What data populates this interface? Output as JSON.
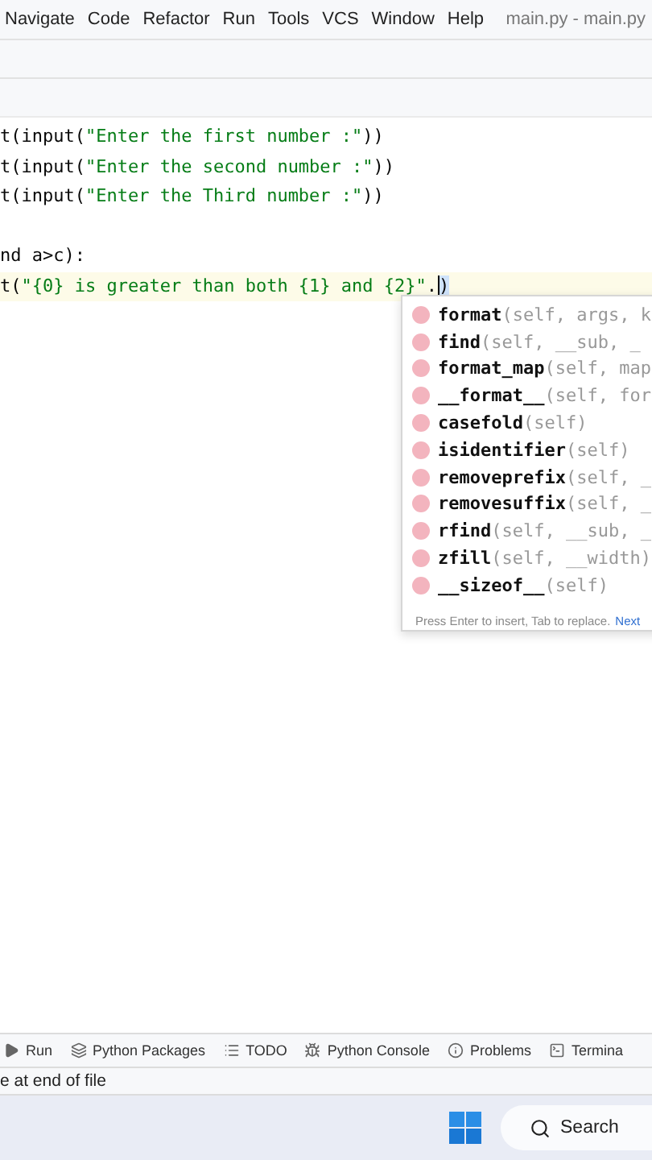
{
  "menu": [
    "Navigate",
    "Code",
    "Refactor",
    "Run",
    "Tools",
    "VCS",
    "Window",
    "Help"
  ],
  "window_title": "main.py - main.py",
  "code_lines": [
    {
      "current": false,
      "segments": [
        {
          "kind": "plain",
          "text": "t(input("
        },
        {
          "kind": "string",
          "text": "\"Enter the first number :\""
        },
        {
          "kind": "plain",
          "text": "))"
        }
      ]
    },
    {
      "current": false,
      "segments": [
        {
          "kind": "plain",
          "text": "t(input("
        },
        {
          "kind": "string",
          "text": "\"Enter the second number :\""
        },
        {
          "kind": "plain",
          "text": "))"
        }
      ]
    },
    {
      "current": false,
      "segments": [
        {
          "kind": "plain",
          "text": "t(input("
        },
        {
          "kind": "string",
          "text": "\"Enter the Third number :\""
        },
        {
          "kind": "plain",
          "text": "))"
        }
      ]
    },
    {
      "kind": "blank"
    },
    {
      "current": false,
      "segments": [
        {
          "kind": "plain",
          "text": "nd a>c):"
        }
      ]
    },
    {
      "current": true,
      "segments": [
        {
          "kind": "plain",
          "text": "t("
        },
        {
          "kind": "string",
          "text": "\"{0} is greater than both {1} and {2}\""
        },
        {
          "kind": "plain",
          "text": "."
        },
        {
          "kind": "caret",
          "text": ")"
        }
      ]
    }
  ],
  "completion": {
    "items": [
      {
        "name": "format",
        "params": "(self, args, k"
      },
      {
        "name": "find",
        "params": "(self, __sub, _"
      },
      {
        "name": "format_map",
        "params": "(self, map"
      },
      {
        "name": "__format__",
        "params": "(self, for"
      },
      {
        "name": "casefold",
        "params": "(self)"
      },
      {
        "name": "isidentifier",
        "params": "(self)"
      },
      {
        "name": "removeprefix",
        "params": "(self, _"
      },
      {
        "name": "removesuffix",
        "params": "(self, _"
      },
      {
        "name": "rfind",
        "params": "(self, __sub, _"
      },
      {
        "name": "zfill",
        "params": "(self, __width)"
      },
      {
        "name": "__sizeof__",
        "params": "(self)"
      }
    ],
    "hint": "Press Enter to insert, Tab to replace.",
    "next_link": "Next"
  },
  "tool_tabs": [
    {
      "kind": "run",
      "label": "Run"
    },
    {
      "kind": "packages",
      "label": "Python Packages"
    },
    {
      "kind": "todo",
      "label": "TODO"
    },
    {
      "kind": "console",
      "label": "Python Console"
    },
    {
      "kind": "problems",
      "label": "Problems"
    },
    {
      "kind": "terminal",
      "label": "Termina"
    }
  ],
  "status": "e at end of file",
  "taskbar": {
    "search": "Search"
  }
}
